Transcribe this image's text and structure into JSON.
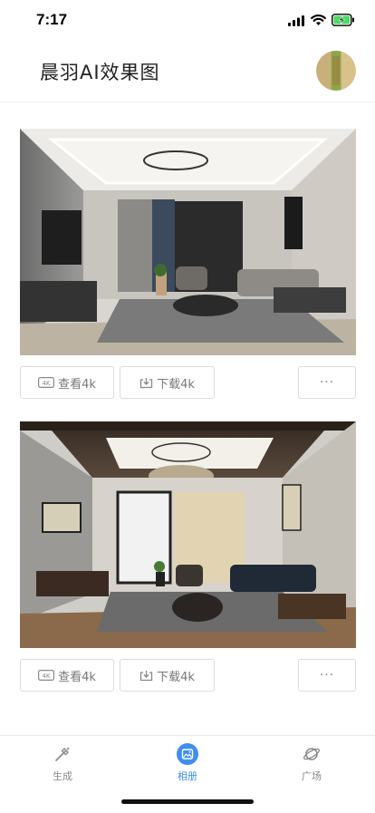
{
  "status": {
    "time": "7:17"
  },
  "header": {
    "title": "晨羽AI效果图"
  },
  "cards": [
    {
      "view_label": "查看4k",
      "download_label": "下载4k",
      "more_label": "···",
      "badge": "4K"
    },
    {
      "view_label": "查看4k",
      "download_label": "下载4k",
      "more_label": "···",
      "badge": "4K"
    }
  ],
  "tabs": [
    {
      "label": "生成",
      "icon": "wand-icon",
      "active": false
    },
    {
      "label": "相册",
      "icon": "album-icon",
      "active": true
    },
    {
      "label": "广场",
      "icon": "planet-icon",
      "active": false
    }
  ],
  "colors": {
    "accent": "#3f8ef0",
    "border": "#dcdcdc",
    "text_muted": "#777777"
  }
}
